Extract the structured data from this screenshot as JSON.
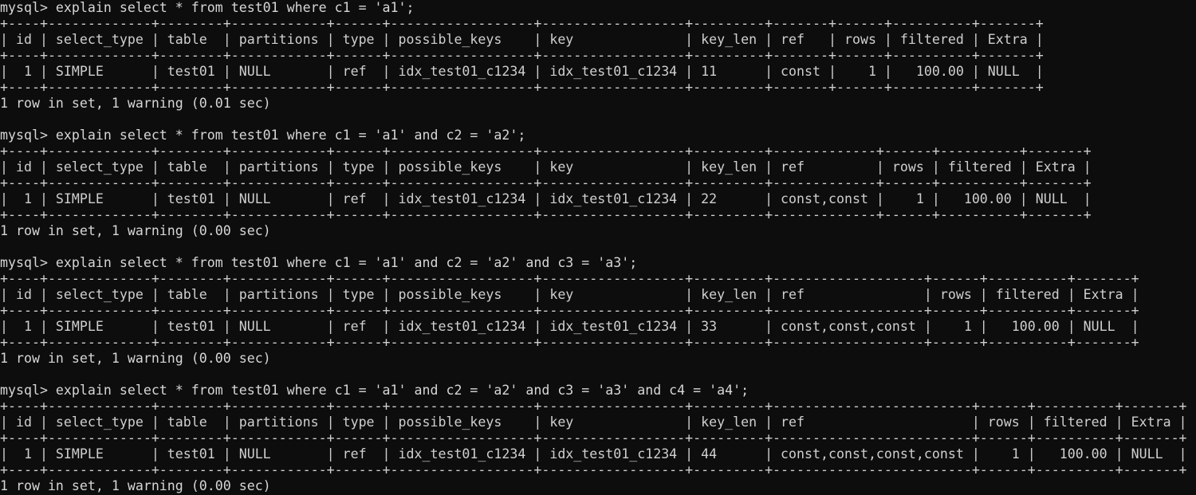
{
  "terminal": {
    "background_color": "#0d0d0d",
    "text_color": "#d6d6d6",
    "prompt": "mysql> ",
    "columns": [
      "id",
      "select_type",
      "table",
      "partitions",
      "type",
      "possible_keys",
      "key",
      "key_len",
      "ref",
      "rows",
      "filtered",
      "Extra"
    ],
    "blocks": [
      {
        "command": "explain select * from test01 where c1 = 'a1';",
        "row": {
          "id": "1",
          "select_type": "SIMPLE",
          "table": "test01",
          "partitions": "NULL",
          "type": "ref",
          "possible_keys": "idx_test01_c1234",
          "key": "idx_test01_c1234",
          "key_len": "11",
          "ref": "const",
          "rows": "1",
          "filtered": "100.00",
          "Extra": "NULL"
        },
        "status": "1 row in set, 1 warning (0.01 sec)"
      },
      {
        "command": "explain select * from test01 where c1 = 'a1' and c2 = 'a2';",
        "row": {
          "id": "1",
          "select_type": "SIMPLE",
          "table": "test01",
          "partitions": "NULL",
          "type": "ref",
          "possible_keys": "idx_test01_c1234",
          "key": "idx_test01_c1234",
          "key_len": "22",
          "ref": "const,const",
          "rows": "1",
          "filtered": "100.00",
          "Extra": "NULL"
        },
        "status": "1 row in set, 1 warning (0.00 sec)"
      },
      {
        "command": "explain select * from test01 where c1 = 'a1' and c2 = 'a2' and c3 = 'a3';",
        "row": {
          "id": "1",
          "select_type": "SIMPLE",
          "table": "test01",
          "partitions": "NULL",
          "type": "ref",
          "possible_keys": "idx_test01_c1234",
          "key": "idx_test01_c1234",
          "key_len": "33",
          "ref": "const,const,const",
          "rows": "1",
          "filtered": "100.00",
          "Extra": "NULL"
        },
        "status": "1 row in set, 1 warning (0.00 sec)"
      },
      {
        "command": "explain select * from test01 where c1 = 'a1' and c2 = 'a2' and c3 = 'a3' and c4 = 'a4';",
        "row": {
          "id": "1",
          "select_type": "SIMPLE",
          "table": "test01",
          "partitions": "NULL",
          "type": "ref",
          "possible_keys": "idx_test01_c1234",
          "key": "idx_test01_c1234",
          "key_len": "44",
          "ref": "const,const,const,const",
          "rows": "1",
          "filtered": "100.00",
          "Extra": "NULL"
        },
        "status": "1 row in set, 1 warning (0.00 sec)"
      }
    ],
    "right_aligned_columns": [
      "id",
      "rows",
      "filtered"
    ],
    "min_widths": {
      "partitions": 10,
      "possible_keys": 16,
      "key": 16
    }
  }
}
